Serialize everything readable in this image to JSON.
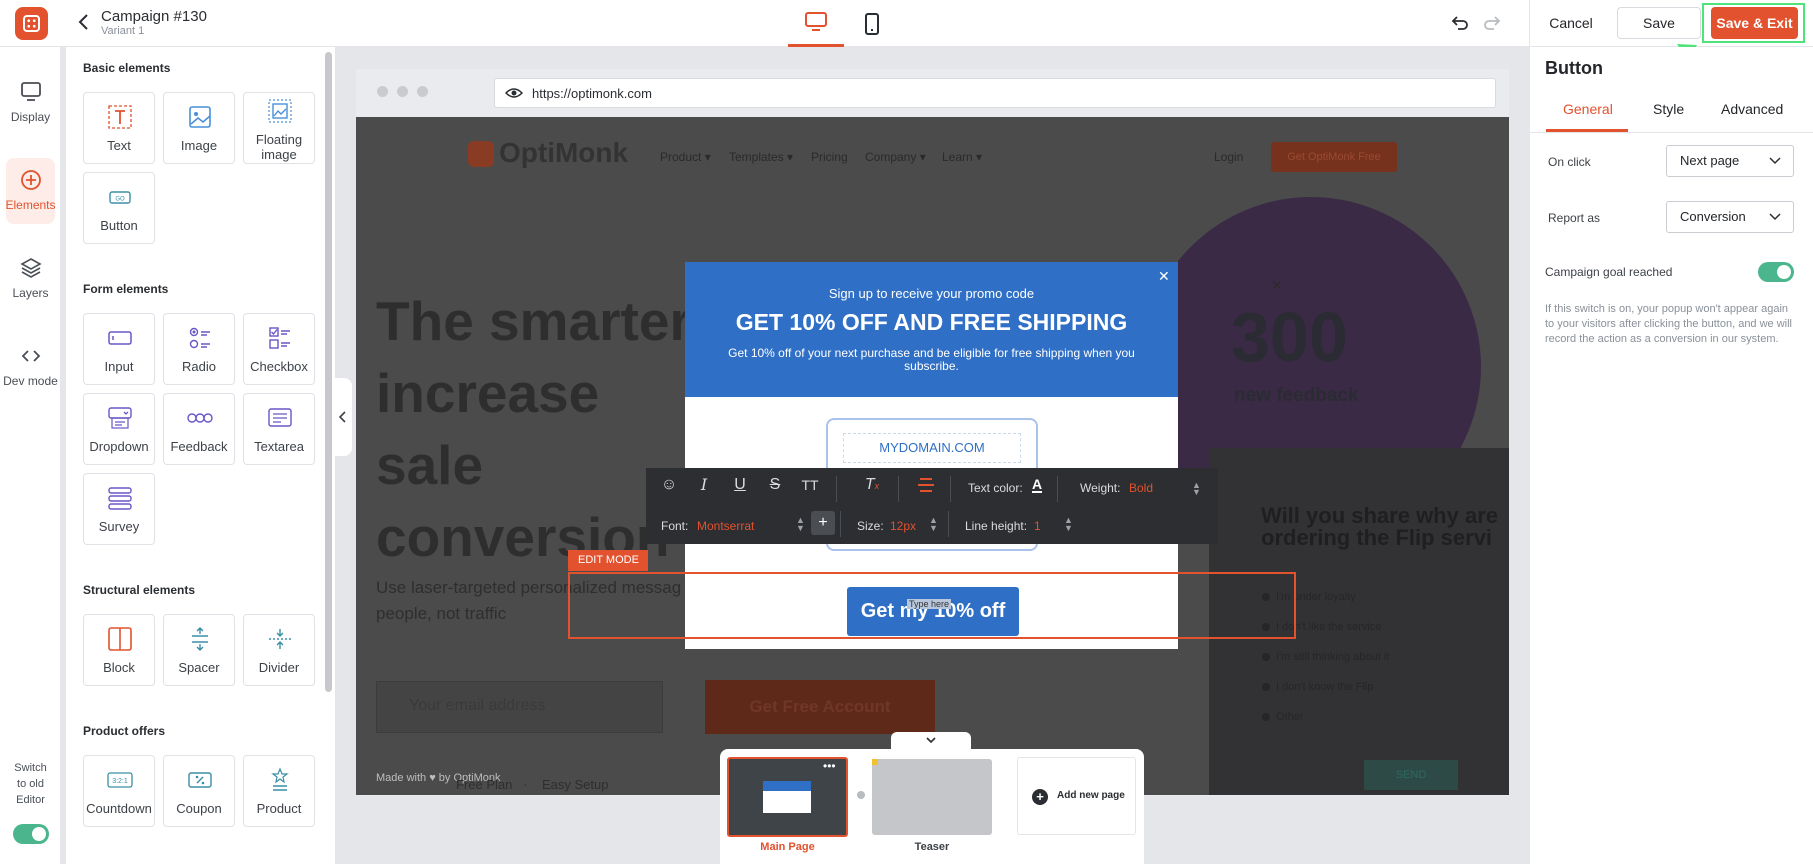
{
  "header": {
    "campaign_title": "Campaign #130",
    "variant": "Variant 1",
    "cancel_label": "Cancel",
    "save_label": "Save",
    "save_exit_label": "Save & Exit"
  },
  "rail": {
    "items": [
      {
        "label": "Display",
        "icon": "monitor-icon"
      },
      {
        "label": "Elements",
        "icon": "plus-circle-icon"
      },
      {
        "label": "Layers",
        "icon": "layers-icon"
      },
      {
        "label": "Dev mode",
        "icon": "code-icon"
      }
    ],
    "switch_label": "Switch to old Editor"
  },
  "panel": {
    "basic_title": "Basic elements",
    "basic": [
      "Text",
      "Image",
      "Floating image",
      "Button"
    ],
    "form_title": "Form elements",
    "form": [
      "Input",
      "Radio",
      "Checkbox",
      "Dropdown",
      "Feedback",
      "Textarea",
      "Survey"
    ],
    "structural_title": "Structural elements",
    "structural": [
      "Block",
      "Spacer",
      "Divider"
    ],
    "offers_title": "Product offers",
    "offers": [
      "Countdown",
      "Coupon",
      "Product"
    ]
  },
  "browser": {
    "url": "https://optimonk.com"
  },
  "site": {
    "logo_name": "OptiMonk",
    "nav": [
      "Product",
      "Templates",
      "Pricing",
      "Company",
      "Learn"
    ],
    "login": "Login",
    "cta": "Get OptiMonk Free",
    "hero": "The smarter increase sale conversion",
    "hero_sub": "Use laser-targeted personalized messag people, not traffic",
    "email_placeholder": "Your email address",
    "free_button": "Get Free Account",
    "big_number": "300",
    "big_number_sub": "new feedback",
    "survey_title": "Will you share why are ordering the Flip servi",
    "survey_options": [
      "I'm under loyalty",
      "I don't like the service",
      "I'm still thinking about it",
      "I don't know the Flip",
      "Other"
    ],
    "survey_send": "SEND",
    "made_with": "Made with ♥ by OptiMonk",
    "features": [
      "Free Plan",
      "Easy Setup"
    ]
  },
  "popup": {
    "line1": "Sign up to receive your promo code",
    "title": "GET 10% OFF AND FREE SHIPPING",
    "desc": "Get 10% off of your next purchase and be eligible for free shipping when you subscribe.",
    "domain": "MYDOMAIN.COM",
    "button": "Get my 10% off",
    "type_here": "Type here"
  },
  "text_toolbar": {
    "text_color_label": "Text color:",
    "weight_label": "Weight:",
    "weight_value": "Bold",
    "font_label": "Font:",
    "font_value": "Montserrat",
    "size_label": "Size:",
    "size_value": "12px",
    "line_height_label": "Line height:",
    "line_height_value": "1"
  },
  "edit_mode_label": "EDIT MODE",
  "pages": {
    "main_label": "Main Page",
    "teaser_label": "Teaser",
    "add_label": "Add new page"
  },
  "right_panel": {
    "title": "Button",
    "tabs": [
      "General",
      "Style",
      "Advanced"
    ],
    "on_click_label": "On click",
    "on_click_value": "Next page",
    "report_label": "Report as",
    "report_value": "Conversion",
    "goal_label": "Campaign goal reached",
    "goal_on": true,
    "help": "If this switch is on, your popup won't appear again to your visitors after clicking the button, and we will record the action as a conversion in our system."
  },
  "colors": {
    "accent": "#e2522e",
    "popup_blue": "#2f6fc6",
    "toggle_green": "#4bb68d",
    "highlight_green": "#4fe37a"
  }
}
